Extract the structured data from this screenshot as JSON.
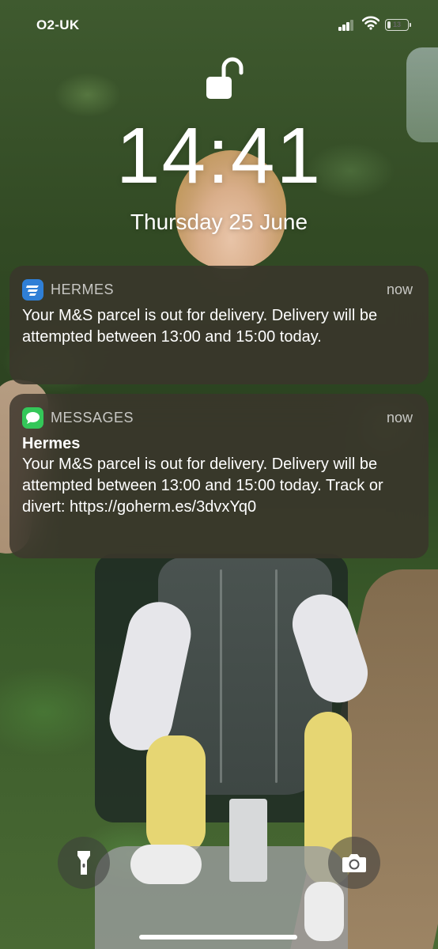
{
  "status_bar": {
    "carrier": "O2-UK",
    "signal_icon": "signal-bars-icon",
    "wifi_icon": "wifi-icon",
    "battery_icon": "battery-icon",
    "battery_label": "13"
  },
  "lock_screen": {
    "lock_icon": "unlocked-padlock-icon",
    "time": "14:41",
    "date": "Thursday 25 June"
  },
  "notifications": [
    {
      "app": "HERMES",
      "app_icon": "hermes-app-icon",
      "time": "now",
      "title": "",
      "body": "Your M&S parcel is out for delivery. Delivery will be attempted between 13:00 and 15:00 today."
    },
    {
      "app": "MESSAGES",
      "app_icon": "messages-app-icon",
      "time": "now",
      "title": "Hermes",
      "body": "Your M&S parcel is out for delivery. Delivery will be attempted between 13:00 and 15:00 today. Track or divert: https://goherm.es/3dvxYq0"
    }
  ],
  "bottom_controls": {
    "flashlight_icon": "flashlight-icon",
    "camera_icon": "camera-icon"
  },
  "colors": {
    "notification_bg": "#3a342c",
    "hermes_icon": "#2f7fd6",
    "messages_icon": "#34c759"
  }
}
